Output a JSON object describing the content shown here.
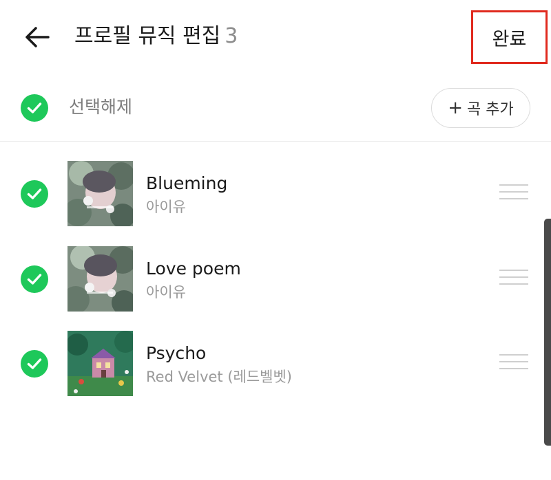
{
  "header": {
    "back_icon": "arrow-left-icon",
    "title": "프로필 뮤직 편집",
    "count": "3",
    "done_label": "완료",
    "done_highlight_color": "#e0291d"
  },
  "selection": {
    "deselect_label": "선택해제",
    "add_song_label": "곡 추가",
    "add_icon": "plus-icon",
    "check_color": "#1ec85a"
  },
  "songs": [
    {
      "title": "Blueming",
      "artist": "아이유",
      "selected": true
    },
    {
      "title": "Love poem",
      "artist": "아이유",
      "selected": true
    },
    {
      "title": "Psycho",
      "artist": "Red Velvet (레드벨벳)",
      "selected": true
    }
  ]
}
